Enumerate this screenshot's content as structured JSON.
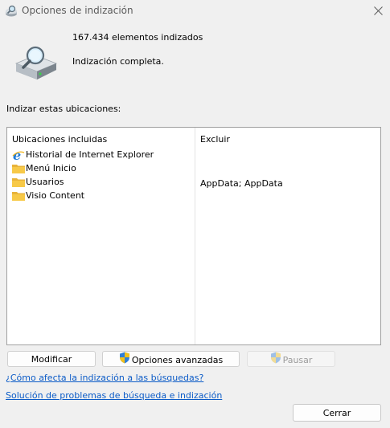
{
  "window": {
    "title": "Opciones de indización"
  },
  "status": {
    "count_text": "167.434 elementos indizados",
    "state_text": "Indización completa."
  },
  "locations": {
    "section_label": "Indizar estas ubicaciones:",
    "column_included": "Ubicaciones incluidas",
    "column_exclude": "Excluir",
    "items": [
      {
        "name": "Historial de Internet Explorer",
        "icon": "internet-explorer-icon",
        "exclude": ""
      },
      {
        "name": "Menú Inicio",
        "icon": "folder-icon",
        "exclude": ""
      },
      {
        "name": "Usuarios",
        "icon": "folder-icon",
        "exclude": "AppData; AppData"
      },
      {
        "name": "Visio Content",
        "icon": "folder-icon",
        "exclude": ""
      }
    ]
  },
  "buttons": {
    "modify": "Modificar",
    "advanced": "Opciones avanzadas",
    "pause": "Pausar",
    "close": "Cerrar"
  },
  "links": {
    "how_affects": "¿Cómo afecta la indización a las búsquedas?",
    "troubleshoot": "Solución de problemas de búsqueda e indización"
  },
  "colors": {
    "link": "#0b5bc7",
    "folder": "#f7c948",
    "ie_blue": "#1f7ad6"
  }
}
